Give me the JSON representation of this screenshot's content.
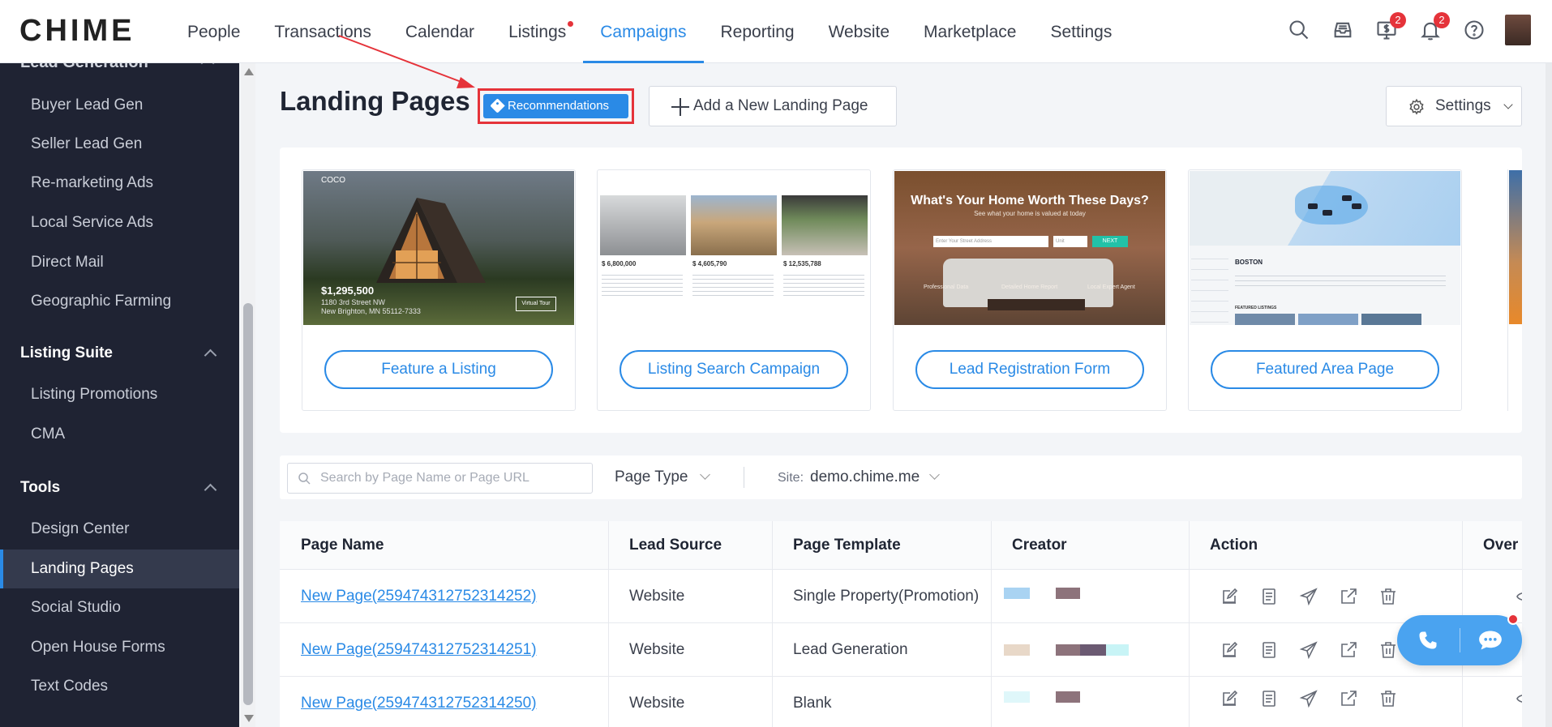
{
  "app": {
    "logo_text_a": "CHI",
    "logo_text_b": "ME"
  },
  "nav": {
    "items": [
      {
        "label": "People"
      },
      {
        "label": "Transactions"
      },
      {
        "label": "Calendar"
      },
      {
        "label": "Listings"
      },
      {
        "label": "Campaigns"
      },
      {
        "label": "Reporting"
      },
      {
        "label": "Website"
      },
      {
        "label": "Marketplace"
      },
      {
        "label": "Settings"
      }
    ],
    "active": "Campaigns",
    "badges": {
      "dollar": "2",
      "bell": "2"
    }
  },
  "sidebar": {
    "cut_section": "Lead Generation",
    "lead_items": [
      "Buyer Lead Gen",
      "Seller Lead Gen",
      "Re-marketing Ads",
      "Local Service Ads",
      "Direct Mail",
      "Geographic Farming"
    ],
    "listing_suite": {
      "title": "Listing Suite",
      "items": [
        "Listing Promotions",
        "CMA"
      ]
    },
    "tools": {
      "title": "Tools",
      "items": [
        "Design Center",
        "Landing Pages",
        "Social Studio",
        "Open House Forms",
        "Text Codes"
      ]
    },
    "active": "Landing Pages"
  },
  "header": {
    "title": "Landing Pages",
    "recommendations_label": "Recommendations",
    "add_label": "Add a New Landing Page",
    "settings_label": "Settings"
  },
  "templates": [
    {
      "button": "Feature a Listing",
      "price": "$1,295,500",
      "addr1": "1180 3rd Street NW",
      "addr2": "New Brighton, MN 55112-7333",
      "logo": "COCO",
      "tour": "Virtual Tour"
    },
    {
      "button": "Listing Search Campaign",
      "prices": [
        "$ 6,800,000",
        "$ 4,605,790",
        "$ 12,535,788"
      ]
    },
    {
      "button": "Lead Registration Form",
      "title": "What's Your Home Worth These Days?",
      "subtitle": "See what your home is valued at today",
      "placeholder": "Enter Your Street Address",
      "placeholder2": "Unit",
      "go": "NEXT",
      "feat": [
        "Professional Data",
        "Detailed Home Report",
        "Local Expert Agent"
      ]
    },
    {
      "button": "Featured Area Page",
      "city": "BOSTON",
      "feat": "FEATURED LISTINGS"
    }
  ],
  "filters": {
    "search_placeholder": "Search by Page Name or Page URL",
    "page_type_label": "Page Type",
    "site_label": "Site:",
    "site_value": "demo.chime.me"
  },
  "table": {
    "headers": [
      "Page Name",
      "Lead Source",
      "Page Template",
      "Creator",
      "Action",
      "Over"
    ],
    "rows": [
      {
        "name": "New Page(259474312752314252)",
        "source": "Website",
        "template": "Single Property(Promotion)"
      },
      {
        "name": "New Page(259474312752314251)",
        "source": "Website",
        "template": "Lead Generation"
      },
      {
        "name": "New Page(259474312752314250)",
        "source": "Website",
        "template": "Blank"
      }
    ]
  },
  "colors": {
    "accent": "#2a8ae6",
    "alert": "#e5333a",
    "sidebar": "#1f2333"
  }
}
